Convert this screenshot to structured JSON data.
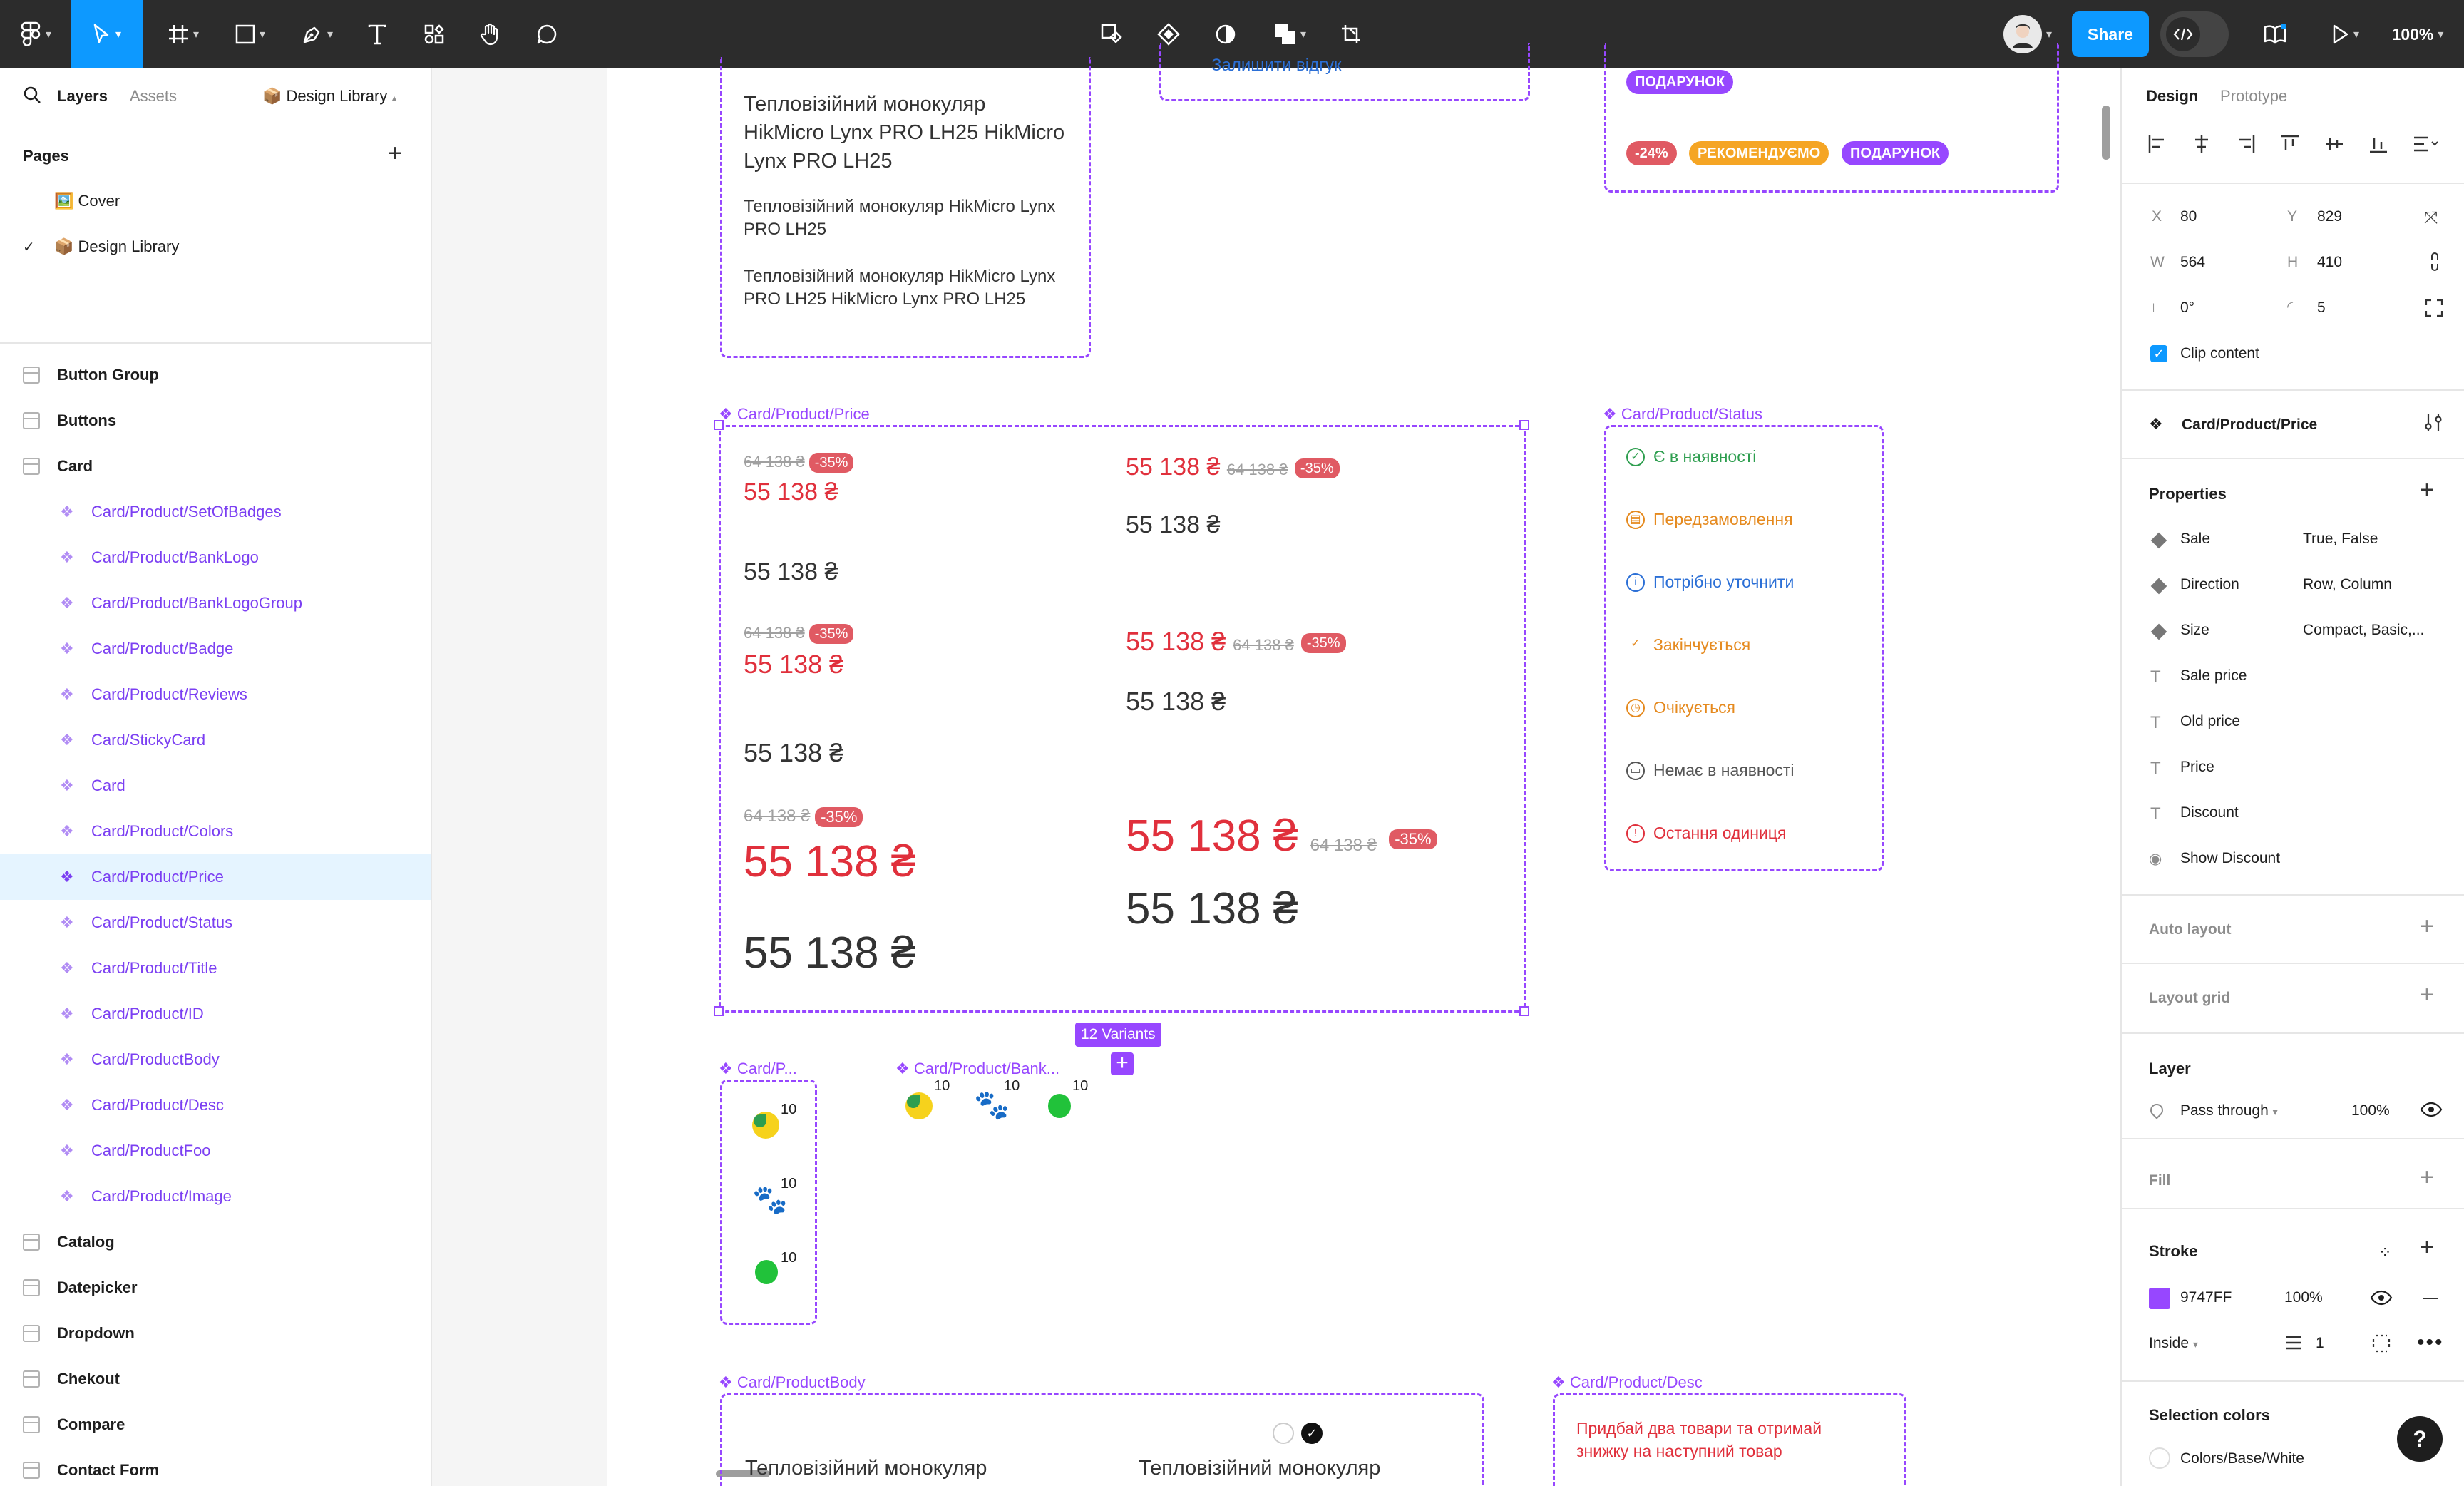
{
  "topbar": {
    "share_label": "Share",
    "zoom": "100%"
  },
  "left": {
    "tabs": {
      "layers": "Layers",
      "assets": "Assets"
    },
    "library_name": "📦 Design Library",
    "pages_title": "Pages",
    "pages": [
      {
        "label": "🖼️ Cover"
      },
      {
        "label": "📦 Design Library"
      }
    ],
    "layers": [
      {
        "label": "Button Group",
        "kind": "frame"
      },
      {
        "label": "Buttons",
        "kind": "frame"
      },
      {
        "label": "Card",
        "kind": "frame"
      },
      {
        "label": "Card/Product/SetOfBadges",
        "kind": "component"
      },
      {
        "label": "Card/Product/BankLogo",
        "kind": "component"
      },
      {
        "label": "Card/Product/BankLogoGroup",
        "kind": "component"
      },
      {
        "label": "Card/Product/Badge",
        "kind": "component"
      },
      {
        "label": "Card/Product/Reviews",
        "kind": "component"
      },
      {
        "label": "Card/StickyCard",
        "kind": "component"
      },
      {
        "label": "Card",
        "kind": "component"
      },
      {
        "label": "Card/Product/Colors",
        "kind": "component"
      },
      {
        "label": "Card/Product/Price",
        "kind": "component",
        "selected": true
      },
      {
        "label": "Card/Product/Status",
        "kind": "component"
      },
      {
        "label": "Card/Product/Title",
        "kind": "component"
      },
      {
        "label": "Card/Product/ID",
        "kind": "component"
      },
      {
        "label": "Card/ProductBody",
        "kind": "component"
      },
      {
        "label": "Card/Product/Desc",
        "kind": "component"
      },
      {
        "label": "Card/ProductFoo",
        "kind": "component"
      },
      {
        "label": "Card/Product/Image",
        "kind": "component"
      },
      {
        "label": "Catalog",
        "kind": "frame"
      },
      {
        "label": "Datepicker",
        "kind": "frame"
      },
      {
        "label": "Dropdown",
        "kind": "frame"
      },
      {
        "label": "Chekout",
        "kind": "frame"
      },
      {
        "label": "Compare",
        "kind": "frame"
      },
      {
        "label": "Contact Form",
        "kind": "frame"
      }
    ]
  },
  "canvas": {
    "title_card": {
      "line1": "Тепловізійний монокуляр HikMicro Lynx PRO LH25 HikMicro Lynx PRO LH25",
      "line2": "Тепловізійний монокуляр HikMicro Lynx PRO LH25",
      "line3": "Тепловізійний монокуляр HikMicro Lynx PRO LH25 HikMicro Lynx PRO LH25"
    },
    "reviews_cut": "Залишити відгук",
    "badges": {
      "gift_top": "ПОДАРУНОК",
      "discount": "-24%",
      "recommended": "РЕКОМЕНДУЄМО",
      "gift": "ПОДАРУНОК"
    },
    "price_title": "Card/Product/Price",
    "price_old": "64 138 ₴",
    "price_sale": "55 138 ₴",
    "price_discount": "-35%",
    "variants_label": "12 Variants",
    "status_title": "Card/Product/Status",
    "statuses": [
      {
        "label": "Є в наявності",
        "color": "#2e9e4f",
        "icon": "check-circle-icon"
      },
      {
        "label": "Передзамовлення",
        "color": "#e58a1f",
        "icon": "calendar-icon"
      },
      {
        "label": "Потрібно уточнити",
        "color": "#2b6fd6",
        "icon": "info-icon"
      },
      {
        "label": "Закінчується",
        "color": "#e58a1f",
        "icon": "check-icon"
      },
      {
        "label": "Очікується",
        "color": "#e58a1f",
        "icon": "clock-icon"
      },
      {
        "label": "Немає в наявності",
        "color": "#555555",
        "icon": "box-icon"
      },
      {
        "label": "Остання одиниця",
        "color": "#e0303c",
        "icon": "alert-icon"
      }
    ],
    "banklogo_group_title": "Card/P...",
    "banklogo_title": "Card/Product/Bank...",
    "bank_count": "10",
    "body_title": "Card/ProductBody",
    "body_text": "Тепловізійний монокуляр",
    "desc_title": "Card/Product/Desc",
    "desc_text_1": "Придбай два товари та отримай",
    "desc_text_2": "знижку на наступний товар"
  },
  "right": {
    "tabs": {
      "design": "Design",
      "prototype": "Prototype"
    },
    "x_label": "X",
    "x": "80",
    "y_label": "Y",
    "y": "829",
    "w_label": "W",
    "w": "564",
    "h_label": "H",
    "h": "410",
    "rotation": "0°",
    "radius": "5",
    "clip": "Clip content",
    "component_name": "Card/Product/Price",
    "properties_title": "Properties",
    "properties": [
      {
        "name": "Sale",
        "value": "True, False",
        "type": "variant"
      },
      {
        "name": "Direction",
        "value": "Row, Column",
        "type": "variant"
      },
      {
        "name": "Size",
        "value": "Compact, Basic,...",
        "type": "variant"
      },
      {
        "name": "Sale price",
        "value": "",
        "type": "text"
      },
      {
        "name": "Old price",
        "value": "",
        "type": "text"
      },
      {
        "name": "Price",
        "value": "",
        "type": "text"
      },
      {
        "name": "Discount",
        "value": "",
        "type": "text"
      },
      {
        "name": "Show Discount",
        "value": "",
        "type": "boolean"
      }
    ],
    "auto_layout": "Auto layout",
    "layout_grid": "Layout grid",
    "layer_title": "Layer",
    "blend": "Pass through",
    "layer_opacity": "100%",
    "fill_title": "Fill",
    "stroke_title": "Stroke",
    "stroke_color": "9747FF",
    "stroke_opacity": "100%",
    "stroke_position": "Inside",
    "stroke_weight": "1",
    "selection_colors": "Selection colors",
    "selection_color_name": "Colors/Base/White"
  },
  "colors": {
    "accent": "#9747ff",
    "share_blue": "#0d99ff",
    "sale_red": "#e0303c"
  }
}
